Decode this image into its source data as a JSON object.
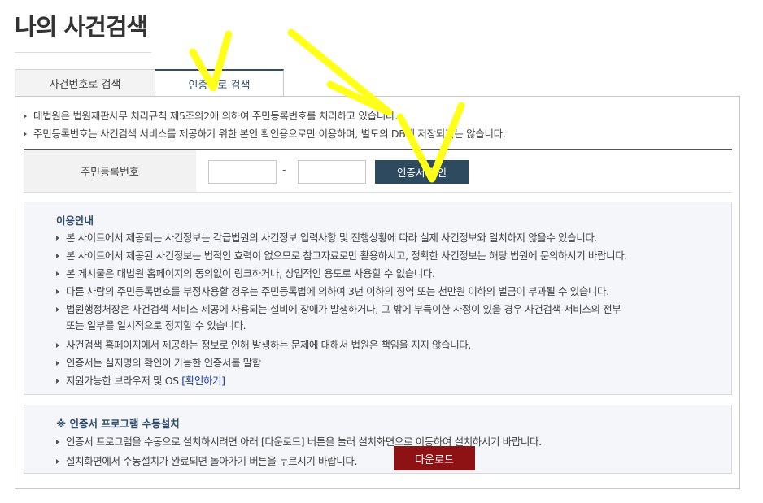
{
  "page": {
    "title": "나의 사건검색"
  },
  "tabs": [
    {
      "label": "사건번호로 검색",
      "active": false
    },
    {
      "label": "인증서로 검색",
      "active": true
    }
  ],
  "notices": [
    "대법원은 법원재판사무 처리규칙 제5조의2에 의하여 주민등록번호를 처리하고 있습니다.",
    "주민등록번호는 사건검색 서비스를 제공하기 위한 본인 확인용으로만 이용하며, 별도의 DB에 저장되지는 않습니다."
  ],
  "form": {
    "label": "주민등록번호",
    "jumin_first": "",
    "jumin_second": "",
    "separator": "-",
    "confirm_button": "인증서 확인"
  },
  "usage": {
    "title": "이용안내",
    "items": [
      "본 사이트에서 제공되는 사건정보는 각급법원의 사건정보 입력사항 및 진행상황에 따라 실제 사건정보와 일치하지 않을수 있습니다.",
      "본 사이트에서 제공된 사건정보는 법적인 효력이 없으므로 참고자료로만 활용하시고, 정확한 사건정보는 해당 법원에 문의하시기 바랍니다.",
      "본 게시물은 대법원 홈페이지의 동의없이 링크하거나, 상업적인 용도로 사용할 수 없습니다.",
      "다른 사람의 주민등록번호를 부정사용할 경우는 주민등록법에 의하여 3년 이하의 징역 또는 천만원 이하의 벌금이 부과될 수 있습니다.",
      "법원행정처장은 사건검색 서비스 제공에 사용되는 설비에 장애가 발생하거나, 그 밖에 부득이한 사정이 있을 경우 사건검색 서비스의 전부",
      "사건검색 홈페이지에서 제공하는 정보로 인해 발생하는 문제에 대해서 법원은 책임을 지지 않습니다.",
      "인증서는 실지명의 확인이 가능한 인증서를 말함",
      "지원가능한 브라우저 및 OS"
    ],
    "item5_continued": "또는 일부를 일시적으로 정지할 수 있습니다.",
    "check_link": "[확인하기]"
  },
  "install": {
    "title": "※ 인증서 프로그램 수동설치",
    "items": [
      "인증서 프로그램을 수동으로 설치하시려면 아래 [다운로드] 버튼을 눌러 설치화면으로 이동하여 설치하시기 바랍니다.",
      "설치화면에서 수동설치가 완료되면 돌아가기 버튼을 누르시기 바랍니다."
    ],
    "download_button": "다운로드"
  },
  "colors": {
    "active_tab": "#2f4c6b",
    "confirm_button": "#2e4a5f",
    "download_button": "#8e1213",
    "annotation": "#ffff1a"
  }
}
